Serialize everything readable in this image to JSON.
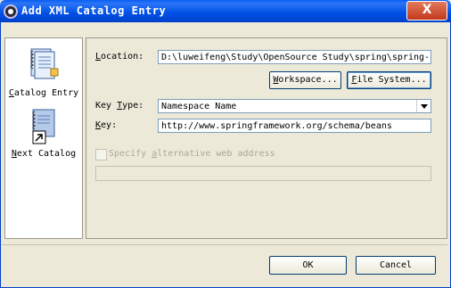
{
  "window": {
    "title": "Add XML Catalog Entry",
    "close_label": "X"
  },
  "sidebar": {
    "items": [
      {
        "label_u": "C",
        "label_rest": "atalog Entry",
        "icon": "catalog-entry-icon"
      },
      {
        "label_u": "N",
        "label_rest": "ext Catalog",
        "icon": "next-catalog-icon"
      }
    ]
  },
  "form": {
    "location": {
      "label_u": "L",
      "label_rest": "ocation:",
      "value": "D:\\luweifeng\\Study\\OpenSource Study\\spring\\spring-"
    },
    "workspace_button": {
      "label_u": "W",
      "label_rest": "orkspace..."
    },
    "filesystem_button": {
      "label_u": "F",
      "label_rest": "ile System..."
    },
    "key_type": {
      "label_pre": "Key ",
      "label_u": "T",
      "label_rest": "ype:",
      "value": "Namespace Name"
    },
    "key": {
      "label_u": "K",
      "label_rest": "ey:",
      "value": "http://www.springframework.org/schema/beans"
    },
    "alt_web": {
      "label_pre": "Specify ",
      "label_u": "a",
      "label_rest": "lternative web address",
      "checked": false,
      "value": ""
    }
  },
  "buttons": {
    "ok": "OK",
    "cancel": "Cancel"
  }
}
